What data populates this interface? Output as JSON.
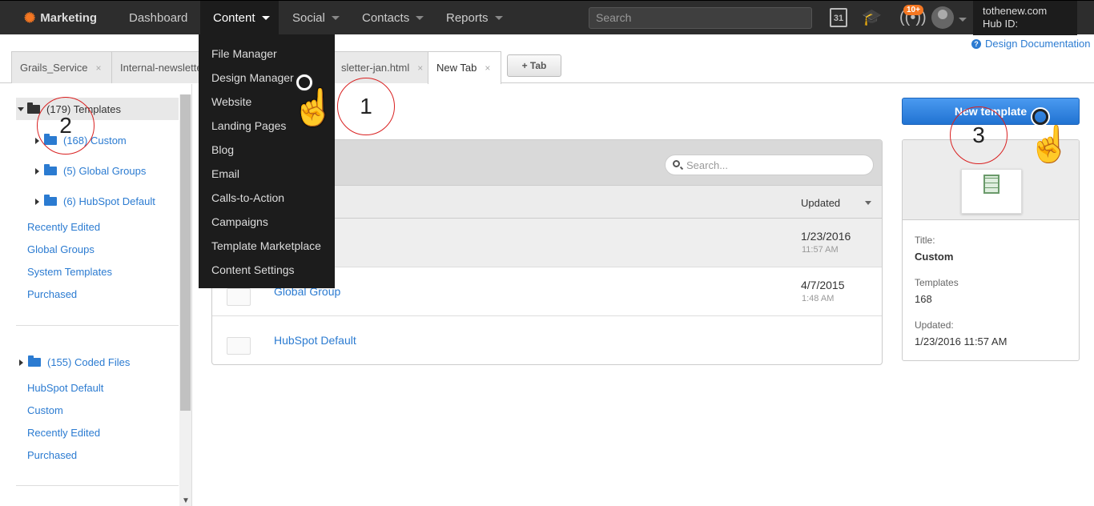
{
  "app": {
    "name": "Marketing"
  },
  "topnav": [
    {
      "label": "Dashboard"
    },
    {
      "label": "Content"
    },
    {
      "label": "Social"
    },
    {
      "label": "Contacts"
    },
    {
      "label": "Reports"
    }
  ],
  "search": {
    "placeholder": "Search"
  },
  "notifications": {
    "badge": "10+"
  },
  "calendar": {
    "day": "31"
  },
  "account": {
    "name": "tothenew.com",
    "hub_id_label": "Hub ID:"
  },
  "docs": {
    "label": "Design Documentation"
  },
  "tabs": [
    {
      "label": "Grails_Service"
    },
    {
      "label": "Internal-newsletter"
    },
    {
      "label": "sletter-jan.html"
    },
    {
      "label": "New Tab"
    }
  ],
  "add_tab": {
    "label": "+ Tab"
  },
  "dropdown": [
    {
      "label": "File Manager"
    },
    {
      "label": "Design Manager"
    },
    {
      "label": "Website"
    },
    {
      "label": "Landing Pages"
    },
    {
      "label": "Blog"
    },
    {
      "label": "Email"
    },
    {
      "label": "Calls-to-Action"
    },
    {
      "label": "Campaigns"
    },
    {
      "label": "Template Marketplace"
    },
    {
      "label": "Content Settings"
    }
  ],
  "sidebar": {
    "root": {
      "label": "(179) Templates"
    },
    "folders": [
      {
        "label": "(168) Custom"
      },
      {
        "label": "(5) Global Groups"
      },
      {
        "label": "(6) HubSpot Default"
      }
    ],
    "links": [
      {
        "label": "Recently Edited"
      },
      {
        "label": "Global Groups"
      },
      {
        "label": "System Templates"
      },
      {
        "label": "Purchased"
      }
    ],
    "coded_root": {
      "label": "(155) Coded Files"
    },
    "coded_links": [
      {
        "label": "HubSpot Default"
      },
      {
        "label": "Custom"
      },
      {
        "label": "Recently Edited"
      },
      {
        "label": "Purchased"
      }
    ]
  },
  "list": {
    "search_placeholder": "Search...",
    "updated_header": "Updated",
    "rows": [
      {
        "name": "",
        "date": "1/23/2016",
        "time": "11:57 AM"
      },
      {
        "name": "Global Group",
        "date": "4/7/2015",
        "time": "1:48 AM"
      },
      {
        "name": "HubSpot Default",
        "date": "",
        "time": ""
      }
    ]
  },
  "new_template": {
    "label": "New template"
  },
  "info": {
    "title_label": "Title:",
    "title_value": "Custom",
    "templates_label": "Templates",
    "templates_value": "168",
    "updated_label": "Updated:",
    "updated_value": "1/23/2016 11:57 AM"
  },
  "annotations": [
    {
      "label": "1"
    },
    {
      "label": "2"
    },
    {
      "label": "3"
    }
  ]
}
